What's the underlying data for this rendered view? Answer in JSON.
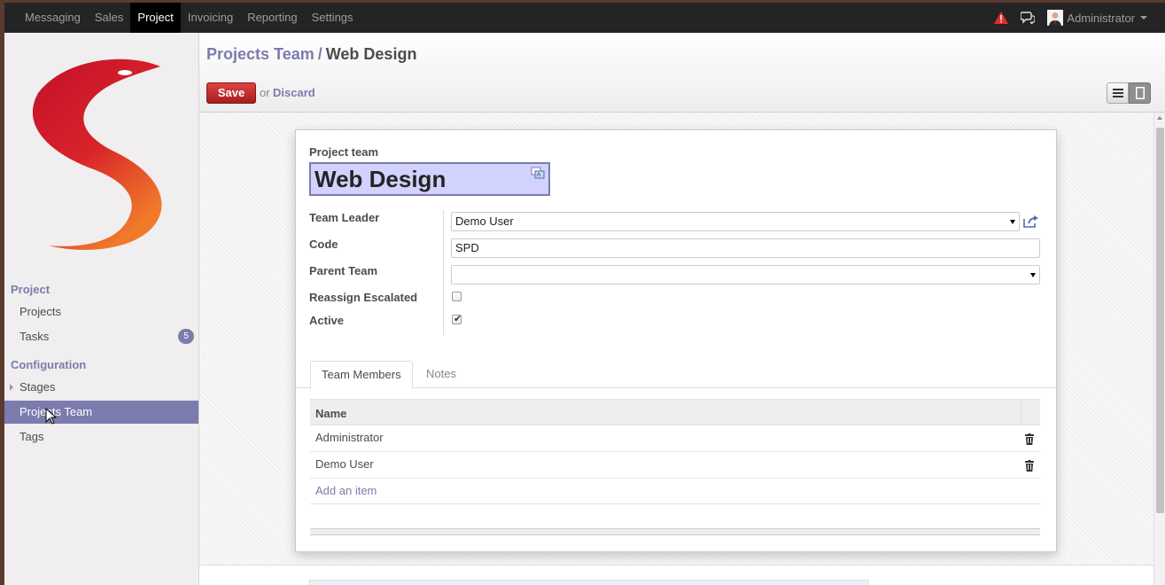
{
  "topbar": {
    "menu": [
      {
        "label": "Messaging"
      },
      {
        "label": "Sales"
      },
      {
        "label": "Project",
        "active": true
      },
      {
        "label": "Invoicing"
      },
      {
        "label": "Reporting"
      },
      {
        "label": "Settings"
      }
    ],
    "user_name": "Administrator"
  },
  "sidebar": {
    "sections": [
      {
        "label": "Project"
      },
      {
        "label": "Configuration"
      }
    ],
    "items": [
      {
        "label": "Projects"
      },
      {
        "label": "Tasks",
        "badge": "5"
      },
      {
        "label": "Stages",
        "expandable": true
      },
      {
        "label": "Projects Team",
        "active": true
      },
      {
        "label": "Tags"
      }
    ]
  },
  "breadcrumb": {
    "parent": "Projects Team",
    "separator": "/",
    "current": "Web Design"
  },
  "toolbar": {
    "save_label": "Save",
    "or_text": "or",
    "discard_label": "Discard"
  },
  "form": {
    "title_label": "Project team",
    "title_value": "Web Design",
    "fields": {
      "team_leader": {
        "label": "Team Leader",
        "value": "Demo User"
      },
      "code": {
        "label": "Code",
        "value": "SPD"
      },
      "parent_team": {
        "label": "Parent Team",
        "value": ""
      },
      "reassign_escalated": {
        "label": "Reassign Escalated",
        "checked": false
      },
      "active": {
        "label": "Active",
        "checked": true
      }
    }
  },
  "tabs": [
    {
      "label": "Team Members",
      "active": true
    },
    {
      "label": "Notes"
    }
  ],
  "members_table": {
    "header": "Name",
    "rows": [
      "Administrator",
      "Demo User"
    ],
    "add_item_label": "Add an item"
  },
  "colors": {
    "accent": "#7c7bad",
    "save": "#b92c28",
    "topbar": "#242424"
  },
  "icons": [
    "alert-icon",
    "chat-icon",
    "list-view-icon",
    "form-view-icon",
    "translate-icon",
    "external-link-icon",
    "trash-icon",
    "mouse-cursor-icon"
  ]
}
